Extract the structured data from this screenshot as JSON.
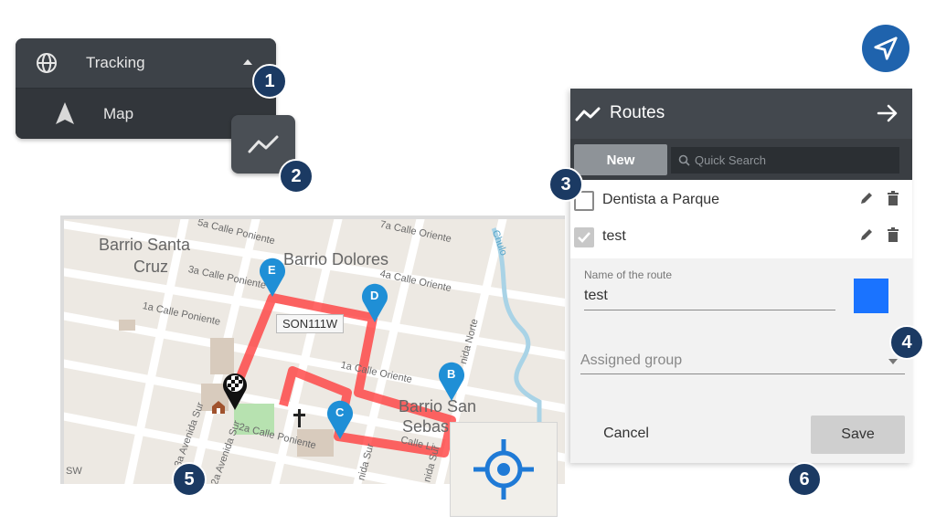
{
  "menu": {
    "tracking_label": "Tracking",
    "map_label": "Map"
  },
  "routes_panel": {
    "title": "Routes",
    "new_button": "New",
    "search_placeholder": "Quick Search",
    "routes": [
      {
        "name": "Dentista a Parque",
        "checked": false
      },
      {
        "name": "test",
        "checked": true
      }
    ],
    "form": {
      "name_label": "Name of the route",
      "name_value": "test",
      "route_color": "#1a73ff",
      "group_placeholder": "Assigned group"
    },
    "cancel_button": "Cancel",
    "save_button": "Save"
  },
  "map": {
    "districts": [
      "Barrio Santa",
      "Cruz",
      "Barrio Dolores",
      "Barrio San",
      "Sebas"
    ],
    "streets": [
      "5a Calle Poniente",
      "3a Calle Poniente",
      "1a Calle Poniente",
      "7a Calle Oriente",
      "4a Calle Oriente",
      "1a Calle Oriente",
      "2a Calle Poniente",
      "Calle Li",
      "3a Avenida Sur",
      "2a Avenida Sur",
      "nida Sur",
      "nida Sur",
      "nida Norte",
      "Chulo",
      "SW",
      "mero"
    ],
    "plate": "SON111W",
    "markers": [
      "A",
      "B",
      "C",
      "D",
      "E"
    ],
    "route_color": "#ff3b3b",
    "marker_color": "#1f8fd6"
  },
  "badges": [
    "1",
    "2",
    "3",
    "4",
    "5",
    "6"
  ],
  "colors": {
    "badge": "#1b3a63",
    "nav_button": "#1f63ad"
  }
}
